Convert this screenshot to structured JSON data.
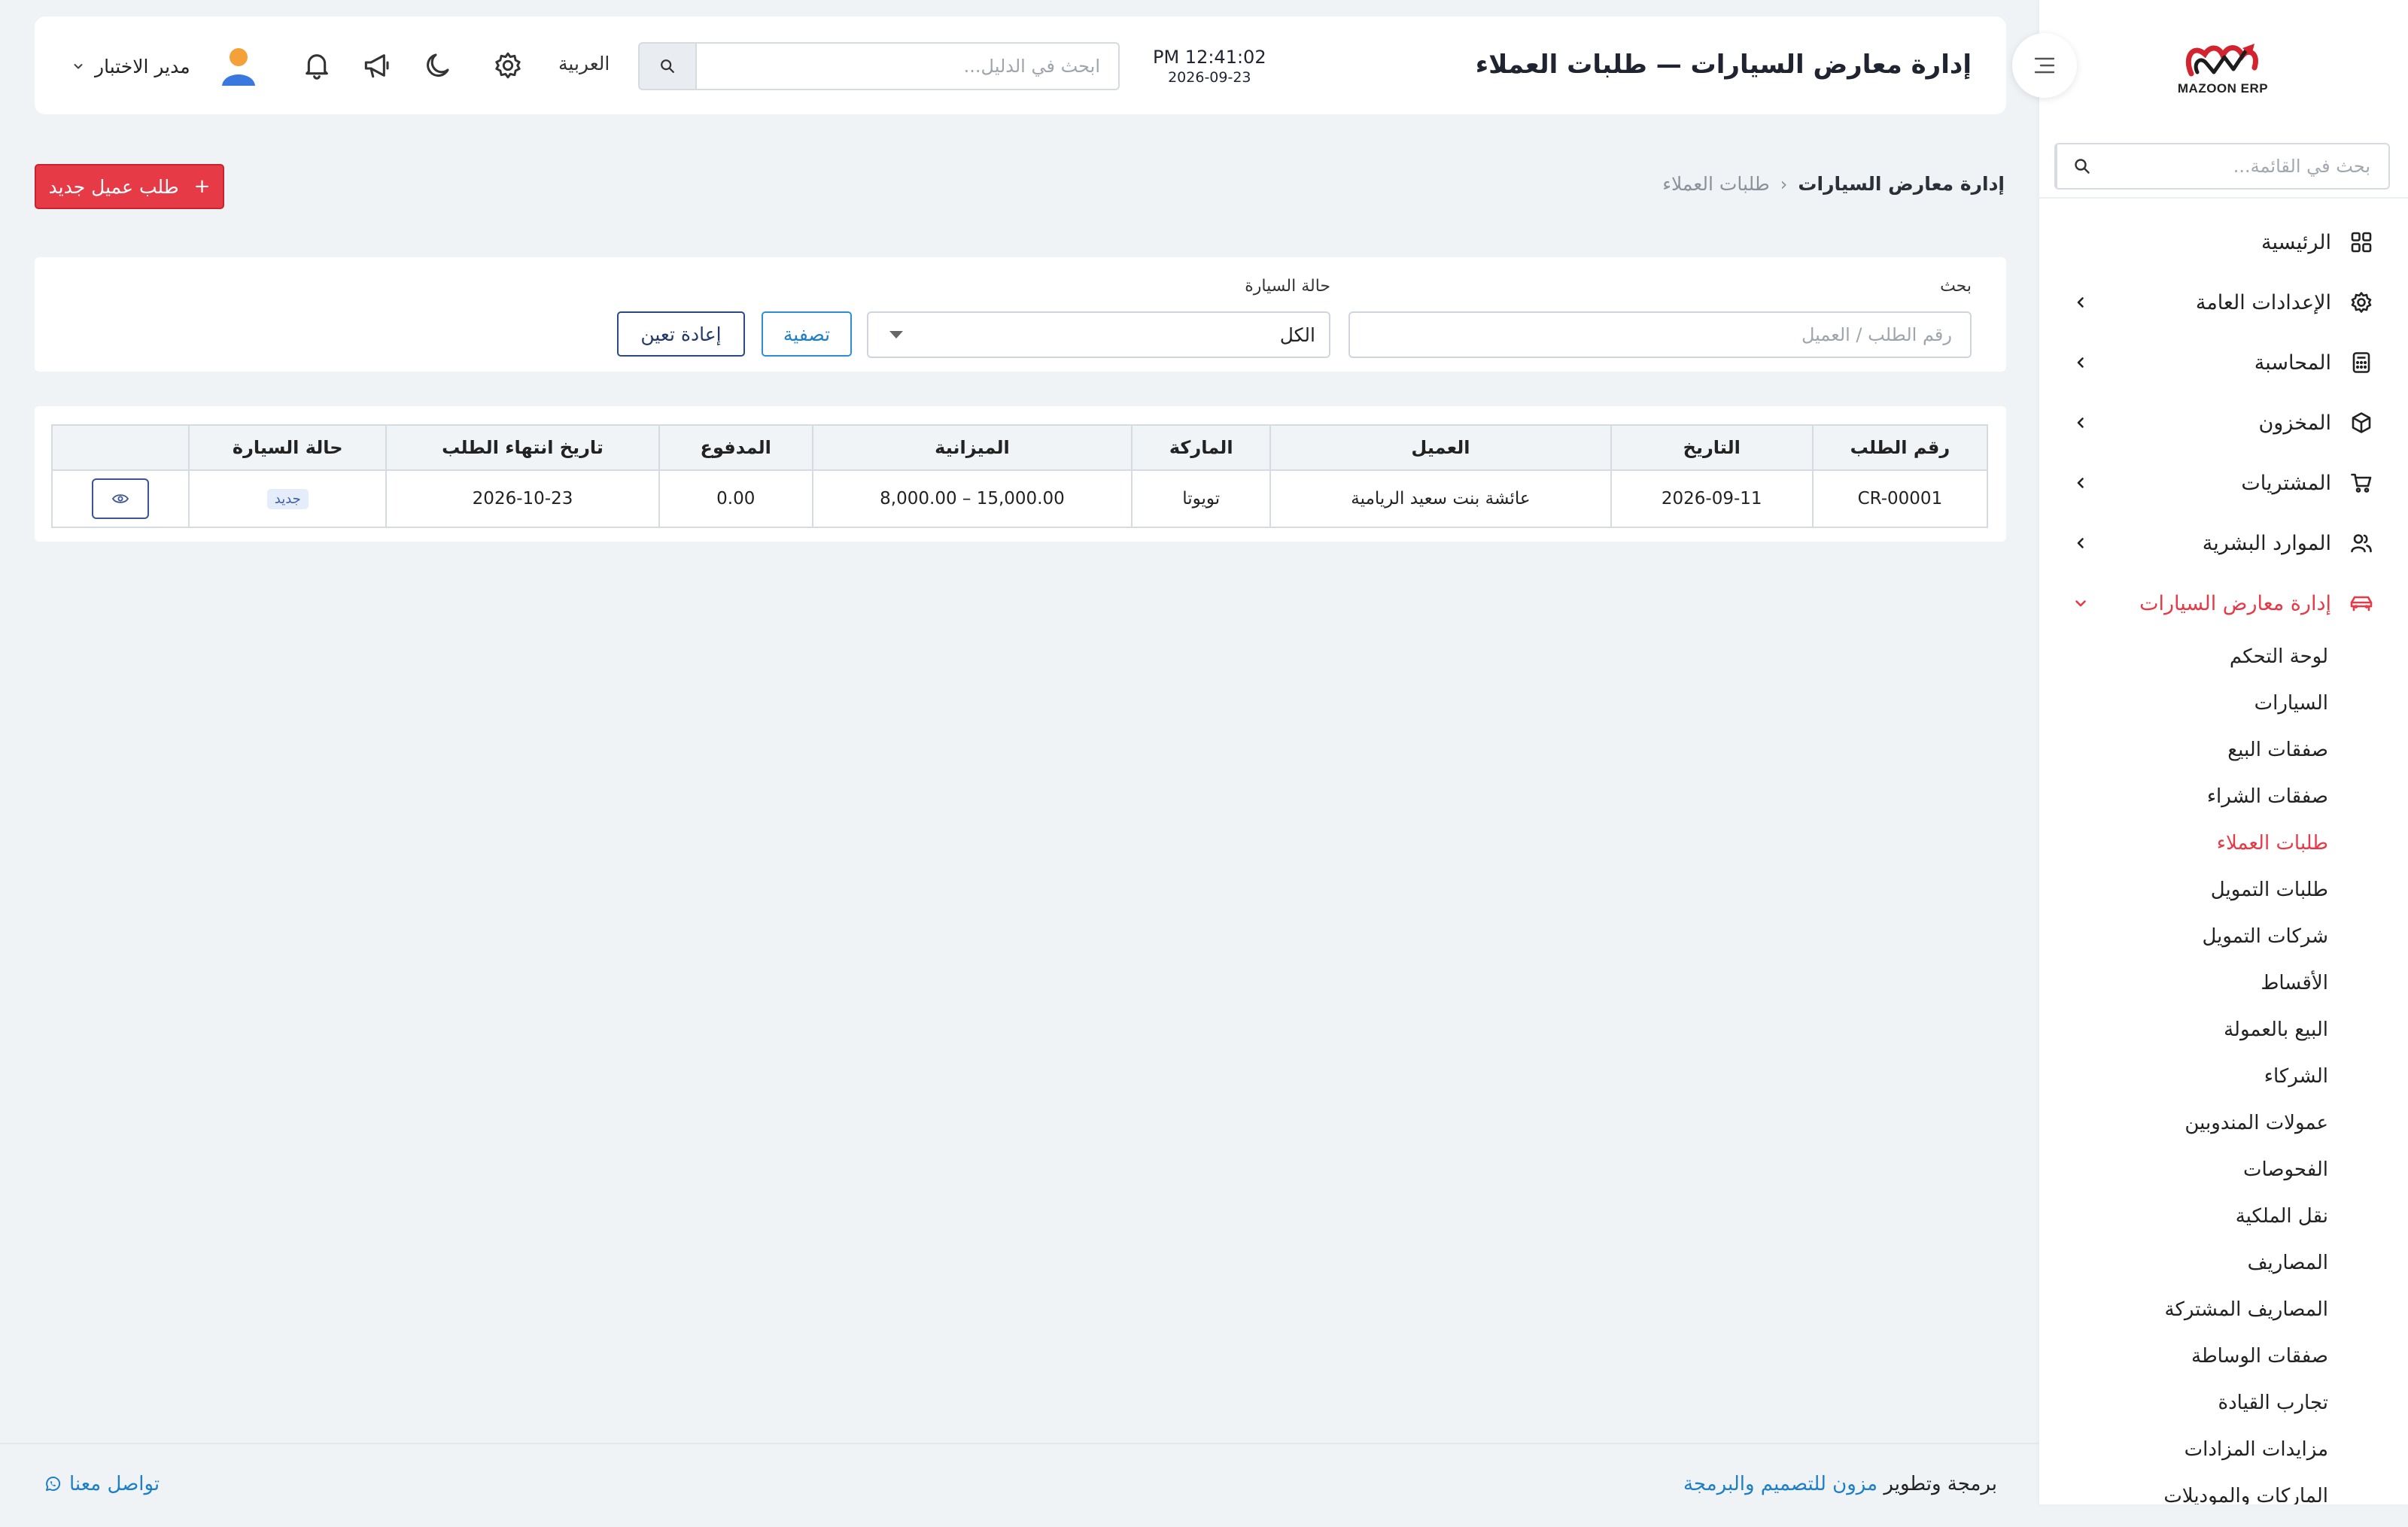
{
  "app": {
    "brand": "MAZOON ERP"
  },
  "header": {
    "title": "إدارة معارض السيارات — طلبات العملاء",
    "time": "PM 12:41:02",
    "date": "2026-09-23",
    "search_placeholder": "ابحث في الدليل...",
    "language": "العربية",
    "user_name": "مدير الاختبار"
  },
  "sidebar": {
    "search_placeholder": "بحث في القائمة...",
    "items": [
      {
        "label": "الرئيسية",
        "icon": "grid-icon"
      },
      {
        "label": "الإعدادات العامة",
        "icon": "gear-icon"
      },
      {
        "label": "المحاسبة",
        "icon": "calculator-icon"
      },
      {
        "label": "المخزون",
        "icon": "box-icon"
      },
      {
        "label": "المشتريات",
        "icon": "cart-icon"
      },
      {
        "label": "الموارد البشرية",
        "icon": "users-icon"
      },
      {
        "label": "إدارة معارض السيارات",
        "icon": "car-icon"
      }
    ],
    "subitems": [
      "لوحة التحكم",
      "السيارات",
      "صفقات البيع",
      "صفقات الشراء",
      "طلبات العملاء",
      "طلبات التمويل",
      "شركات التمويل",
      "الأقساط",
      "البيع بالعمولة",
      "الشركاء",
      "عمولات المندوبين",
      "الفحوصات",
      "نقل الملكية",
      "المصاريف",
      "المصاريف المشتركة",
      "صفقات الوساطة",
      "تجارب القيادة",
      "مزايدات المزادات",
      "الماركات والموديلات"
    ],
    "active_subitem": "طلبات العملاء"
  },
  "breadcrumb": {
    "root": "إدارة معارض السيارات",
    "sep": "‹",
    "current": "طلبات العملاء"
  },
  "actions": {
    "new_request": "طلب عميل جديد",
    "plus": "+"
  },
  "filters": {
    "search_label": "بحث",
    "search_placeholder": "رقم الطلب / العميل",
    "status_label": "حالة السيارة",
    "status_value": "الكل",
    "filter_button": "تصفية",
    "reset_button": "إعادة تعين"
  },
  "table": {
    "headers": {
      "number": "رقم الطلب",
      "date": "التاريخ",
      "customer": "العميل",
      "brand": "الماركة",
      "budget": "الميزانية",
      "paid": "المدفوع",
      "end_date": "تاريخ انتهاء الطلب",
      "status": "حالة السيارة"
    },
    "rows": [
      {
        "number": "CR-00001",
        "date": "2026-09-11",
        "customer": "عائشة بنت سعيد الريامية",
        "brand": "تويوتا",
        "budget": "8,000.00 – 15,000.00",
        "paid": "0.00",
        "end_date": "2026-10-23",
        "status": "جديد"
      }
    ]
  },
  "footer": {
    "credit_prefix": "برمجة وتطوير",
    "credit_link": "مزون للتصميم والبرمجة",
    "contact": "تواصل معنا"
  },
  "colors": {
    "accent": "#e63a46",
    "link": "#1f7fc6",
    "navy": "#2a4a84"
  }
}
